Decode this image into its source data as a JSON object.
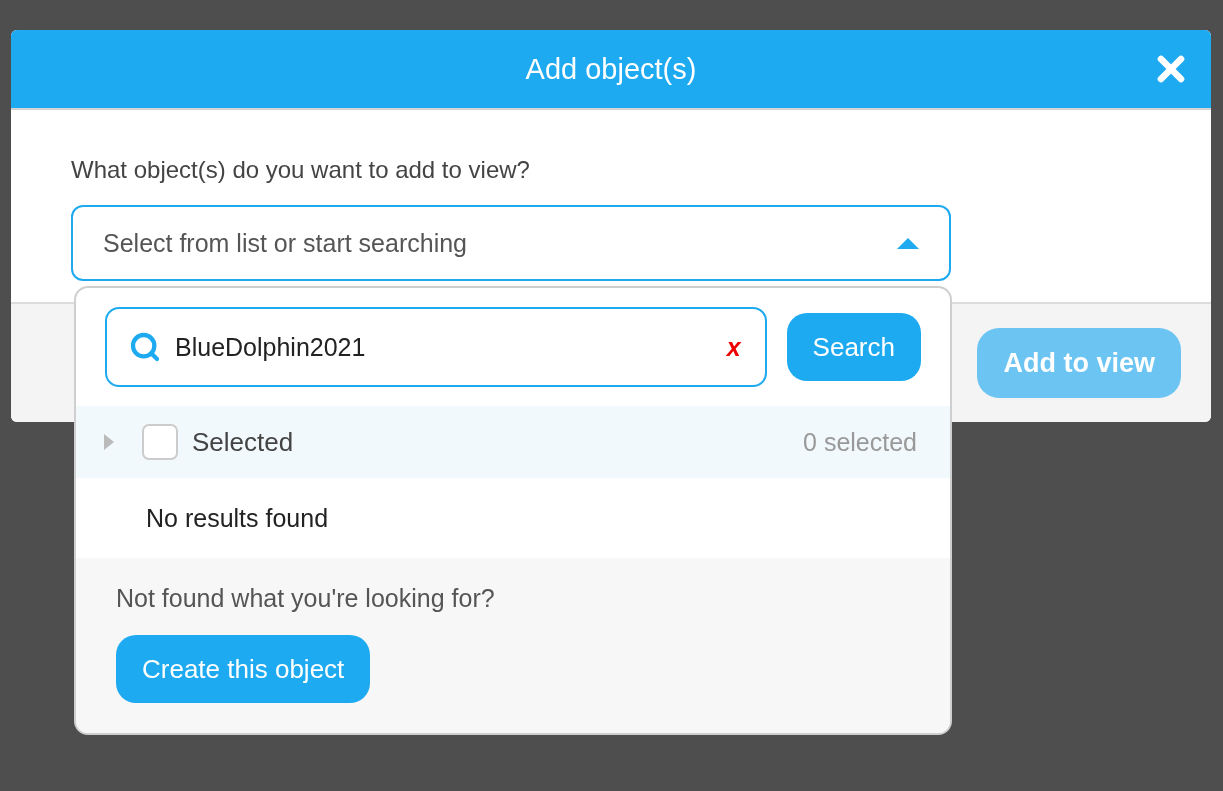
{
  "dialog": {
    "title": "Add object(s)",
    "prompt": "What object(s) do you want to add to view?",
    "select": {
      "placeholder": "Select from list or start searching",
      "expanded": true
    },
    "dropdown": {
      "search": {
        "value": "BlueDolphin2021",
        "clear": "x",
        "button": "Search"
      },
      "selected_group": {
        "label": "Selected",
        "checked": false,
        "expanded": false,
        "count": "0 selected"
      },
      "empty_message": "No results found",
      "footer": {
        "question": "Not found what you're looking for?",
        "button": "Create this object"
      }
    },
    "primary_button": {
      "label": "Add to view",
      "disabled": true
    }
  }
}
